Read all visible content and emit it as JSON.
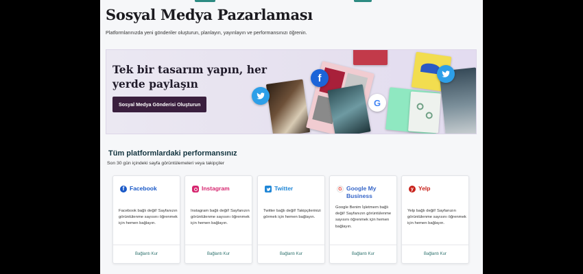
{
  "page": {
    "title": "Sosyal Medya Pazarlaması",
    "subtitle": "Platformlarınızda yeni gönderiler oluşturun, planlayın, yayınlayın ve performansınızı öğrenin."
  },
  "hero": {
    "title": "Tek bir tasarım yapın, her yerde paylaşın",
    "button_label": "Sosyal Medya Gönderisi Oluşturun",
    "collage_icons": [
      "twitter-icon",
      "facebook-icon",
      "google-icon",
      "twitter-icon"
    ]
  },
  "performance": {
    "title": "Tüm platformlardaki performansınız",
    "subtitle": "Son 30 gün içindeki sayfa görüntülemeleri veya takipçiler"
  },
  "platforms": [
    {
      "name": "Facebook",
      "icon": "facebook-icon",
      "color": "#1a59c7",
      "description": "Facebook bağlı değil! Sayfanızın görüntülenme sayısını öğrenmek için hemen bağlayın.",
      "action": "Bağlantı Kur"
    },
    {
      "name": "Instagram",
      "icon": "instagram-icon",
      "color": "#d6266f",
      "description": "Instagram bağlı değil! Sayfanızın görüntülenme sayısını öğrenmek için hemen bağlayın.",
      "action": "Bağlantı Kur"
    },
    {
      "name": "Twitter",
      "icon": "twitter-icon",
      "color": "#1f86d6",
      "description": "Twitter bağlı değil! Takipçilerinizi görmek için hemen bağlayın.",
      "action": "Bağlantı Kur"
    },
    {
      "name": "Google My Business",
      "icon": "google-icon",
      "color": "#3565c8",
      "description": "Google Benim İşletmem bağlı değil! Sayfanızın görüntülenme sayısını öğrenmek için hemen bağlayın.",
      "action": "Bağlantı Kur"
    },
    {
      "name": "Yelp",
      "icon": "yelp-icon",
      "color": "#c8221b",
      "description": "Yelp bağlı değil! Sayfanızın görüntülenme sayısını öğrenmek için hemen bağlayın.",
      "action": "Bağlantı Kur"
    }
  ]
}
